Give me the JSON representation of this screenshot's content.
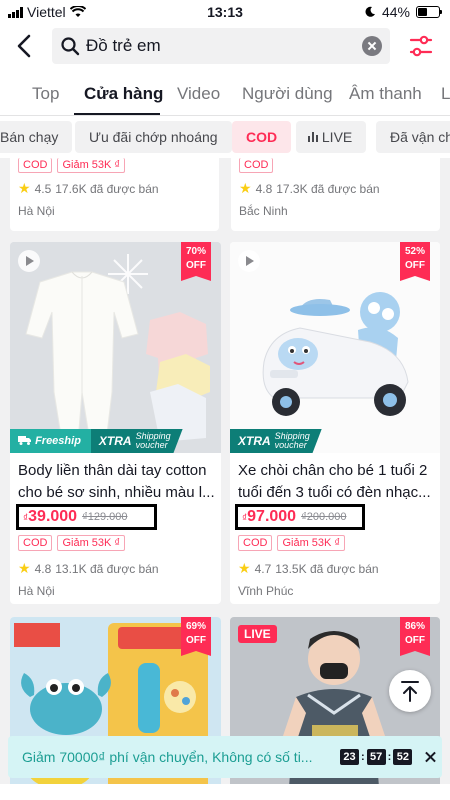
{
  "status": {
    "carrier": "Viettel",
    "time": "13:13",
    "battery": "44%",
    "battery_level": 0.44
  },
  "search": {
    "query": "Đồ trẻ em"
  },
  "tabs": [
    "Top",
    "Cửa hàng",
    "Video",
    "Người dùng",
    "Âm thanh",
    "L"
  ],
  "chips": [
    "Bán chạy",
    "Ưu đãi chớp nhoáng",
    "COD",
    "LIVE",
    "Đã vận chu"
  ],
  "top_strip": [
    {
      "tags": [
        "COD",
        "Giảm 53K ₫"
      ],
      "rating": "4.5",
      "sold": "17.6K đã được bán",
      "location": "Hà Nội"
    },
    {
      "tags": [
        "COD"
      ],
      "rating": "4.8",
      "sold": "17.3K đã được bán",
      "location": "Bắc Ninh"
    }
  ],
  "products": [
    {
      "discount": "70% OFF",
      "freeship": "Freeship",
      "xtra": {
        "brand": "XTRA",
        "line1": "Shipping",
        "line2": "voucher"
      },
      "title": "Body liền thân dài tay cotton cho bé sơ sinh, nhiều màu l...",
      "currency": "₫",
      "price": "39.000",
      "old_price": "₫129.000",
      "tags": [
        "COD",
        "Giảm 53K ₫"
      ],
      "rating": "4.8",
      "sold": "13.1K đã được bán",
      "location": "Hà Nội"
    },
    {
      "discount": "52% OFF",
      "xtra": {
        "brand": "XTRA",
        "line1": "Shipping",
        "line2": "voucher"
      },
      "title": "Xe chòi chân cho bé 1 tuổi 2 tuổi đến 3 tuổi có đèn nhạc...",
      "currency": "₫",
      "price": "97.000",
      "old_price": "₫200.000",
      "tags": [
        "COD",
        "Giảm 53K ₫"
      ],
      "rating": "4.7",
      "sold": "13.5K đã được bán",
      "location": "Vĩnh Phúc"
    },
    {
      "discount": "69% OFF"
    },
    {
      "discount": "86% OFF",
      "live": "LIVE"
    }
  ],
  "banner": {
    "text": "Giảm 70000₫ phí vận chuyển, Không có số ti...",
    "timer": [
      "23",
      "57",
      "52"
    ]
  },
  "colors": {
    "accent": "#fe2c55",
    "teal": "#1c9e93",
    "dark": "#161823"
  }
}
